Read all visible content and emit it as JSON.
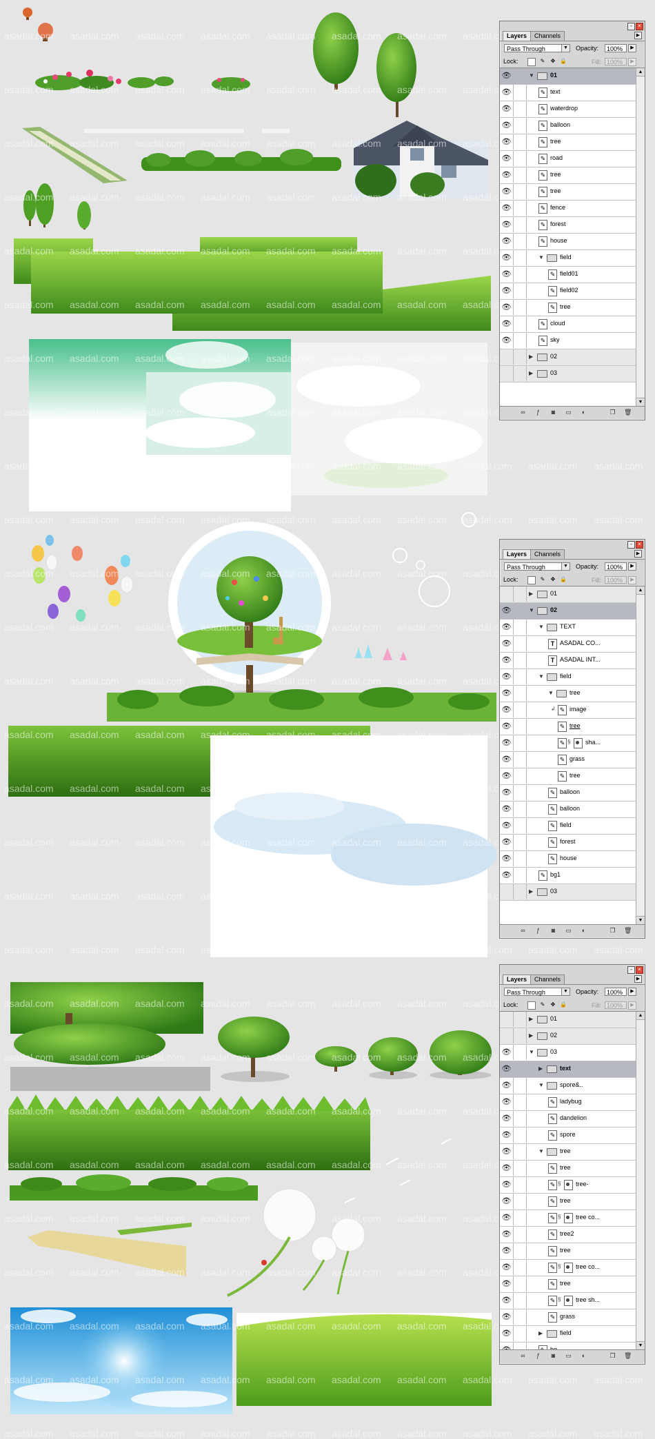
{
  "watermark": "asadal.com",
  "panels": [
    {
      "tabs": [
        "Layers",
        "Channels"
      ],
      "blend_mode": "Pass Through",
      "opacity_label": "Opacity:",
      "opacity": "100%",
      "lock_label": "Lock:",
      "fill_label": "Fill:",
      "fill": "100%",
      "layers": [
        {
          "name": "01",
          "kind": "group",
          "indent": 0,
          "open": true,
          "visible": true,
          "selected": true
        },
        {
          "name": "text",
          "kind": "layer",
          "indent": 1,
          "visible": true
        },
        {
          "name": "waterdrop",
          "kind": "layer",
          "indent": 1,
          "visible": true
        },
        {
          "name": "balloon",
          "kind": "layer",
          "indent": 1,
          "visible": true
        },
        {
          "name": "tree",
          "kind": "layer",
          "indent": 1,
          "visible": true
        },
        {
          "name": "road",
          "kind": "layer",
          "indent": 1,
          "visible": true
        },
        {
          "name": "tree",
          "kind": "layer",
          "indent": 1,
          "visible": true
        },
        {
          "name": "tree",
          "kind": "layer",
          "indent": 1,
          "visible": true
        },
        {
          "name": "fence",
          "kind": "layer",
          "indent": 1,
          "visible": true
        },
        {
          "name": "forest",
          "kind": "layer",
          "indent": 1,
          "visible": true
        },
        {
          "name": "house",
          "kind": "layer",
          "indent": 1,
          "visible": true
        },
        {
          "name": "field",
          "kind": "group",
          "indent": 1,
          "open": true,
          "visible": true
        },
        {
          "name": "field01",
          "kind": "layer",
          "indent": 2,
          "visible": true
        },
        {
          "name": "field02",
          "kind": "layer",
          "indent": 2,
          "visible": true
        },
        {
          "name": "tree",
          "kind": "layer",
          "indent": 2,
          "visible": true
        },
        {
          "name": "cloud",
          "kind": "layer",
          "indent": 1,
          "visible": true
        },
        {
          "name": "sky",
          "kind": "layer",
          "indent": 1,
          "visible": true
        },
        {
          "name": "02",
          "kind": "group",
          "indent": 0,
          "open": false,
          "visible": false
        },
        {
          "name": "03",
          "kind": "group",
          "indent": 0,
          "open": false,
          "visible": false
        }
      ]
    },
    {
      "tabs": [
        "Layers",
        "Channels"
      ],
      "blend_mode": "Pass Through",
      "opacity_label": "Opacity:",
      "opacity": "100%",
      "lock_label": "Lock:",
      "fill_label": "Fill:",
      "fill": "100%",
      "layers": [
        {
          "name": "01",
          "kind": "group",
          "indent": 0,
          "open": false,
          "visible": false
        },
        {
          "name": "02",
          "kind": "group",
          "indent": 0,
          "open": true,
          "visible": true,
          "selected": true
        },
        {
          "name": "TEXT",
          "kind": "group",
          "indent": 1,
          "open": true,
          "visible": true
        },
        {
          "name": "ASADAL CO...",
          "kind": "text",
          "indent": 2,
          "visible": true
        },
        {
          "name": "ASADAL INT...",
          "kind": "text",
          "indent": 2,
          "visible": true
        },
        {
          "name": "field",
          "kind": "group",
          "indent": 1,
          "open": true,
          "visible": true
        },
        {
          "name": "tree",
          "kind": "group",
          "indent": 2,
          "open": true,
          "visible": true
        },
        {
          "name": "image",
          "kind": "clipped",
          "indent": 3,
          "visible": true
        },
        {
          "name": "tree",
          "kind": "layer",
          "indent": 3,
          "visible": true,
          "underline": true
        },
        {
          "name": "sha...",
          "kind": "masked",
          "indent": 3,
          "visible": true
        },
        {
          "name": "grass",
          "kind": "layer",
          "indent": 3,
          "visible": true
        },
        {
          "name": "tree",
          "kind": "layer",
          "indent": 3,
          "visible": true
        },
        {
          "name": "balloon",
          "kind": "layer",
          "indent": 2,
          "visible": true
        },
        {
          "name": "balloon",
          "kind": "layer",
          "indent": 2,
          "visible": true
        },
        {
          "name": "field",
          "kind": "layer",
          "indent": 2,
          "visible": true
        },
        {
          "name": "forest",
          "kind": "layer",
          "indent": 2,
          "visible": true
        },
        {
          "name": "house",
          "kind": "layer",
          "indent": 2,
          "visible": true
        },
        {
          "name": "bg1",
          "kind": "layer",
          "indent": 1,
          "visible": true
        },
        {
          "name": "03",
          "kind": "group",
          "indent": 0,
          "open": false,
          "visible": false
        }
      ]
    },
    {
      "tabs": [
        "Layers",
        "Channels"
      ],
      "blend_mode": "Pass Through",
      "opacity_label": "Opacity:",
      "opacity": "100%",
      "lock_label": "Lock:",
      "fill_label": "Fill:",
      "fill": "100%",
      "layers": [
        {
          "name": "01",
          "kind": "group",
          "indent": 0,
          "open": false,
          "visible": false
        },
        {
          "name": "02",
          "kind": "group",
          "indent": 0,
          "open": false,
          "visible": false
        },
        {
          "name": "03",
          "kind": "group",
          "indent": 0,
          "open": true,
          "visible": true
        },
        {
          "name": "text",
          "kind": "group",
          "indent": 1,
          "open": false,
          "visible": true,
          "selected": true
        },
        {
          "name": "spore&..",
          "kind": "group",
          "indent": 1,
          "open": true,
          "visible": true
        },
        {
          "name": "ladybug",
          "kind": "layer",
          "indent": 2,
          "visible": true
        },
        {
          "name": "dandelion",
          "kind": "layer",
          "indent": 2,
          "visible": true
        },
        {
          "name": "spore",
          "kind": "layer",
          "indent": 2,
          "visible": true
        },
        {
          "name": "tree",
          "kind": "group",
          "indent": 1,
          "open": true,
          "visible": true
        },
        {
          "name": "tree",
          "kind": "layer",
          "indent": 2,
          "visible": true
        },
        {
          "name": "tree-",
          "kind": "masked",
          "indent": 2,
          "visible": true
        },
        {
          "name": "tree",
          "kind": "layer",
          "indent": 2,
          "visible": true
        },
        {
          "name": "tree co...",
          "kind": "masked",
          "indent": 2,
          "visible": true
        },
        {
          "name": "tree2",
          "kind": "layer",
          "indent": 2,
          "visible": true
        },
        {
          "name": "tree",
          "kind": "layer",
          "indent": 2,
          "visible": true
        },
        {
          "name": "tree co...",
          "kind": "masked",
          "indent": 2,
          "visible": true
        },
        {
          "name": "tree",
          "kind": "layer",
          "indent": 2,
          "visible": true
        },
        {
          "name": "tree sh...",
          "kind": "masked",
          "indent": 2,
          "visible": true
        },
        {
          "name": "grass",
          "kind": "layer",
          "indent": 2,
          "visible": true
        },
        {
          "name": "field",
          "kind": "group",
          "indent": 1,
          "open": false,
          "visible": true
        },
        {
          "name": "bg",
          "kind": "layer",
          "indent": 1,
          "visible": true
        }
      ]
    }
  ],
  "colors": {
    "canvas": "#e5e5e5",
    "panel": "#d6d6d6",
    "selected_row": "#b6b8c2",
    "grass": "#5fa62a",
    "sky": "#4fb3e6"
  }
}
